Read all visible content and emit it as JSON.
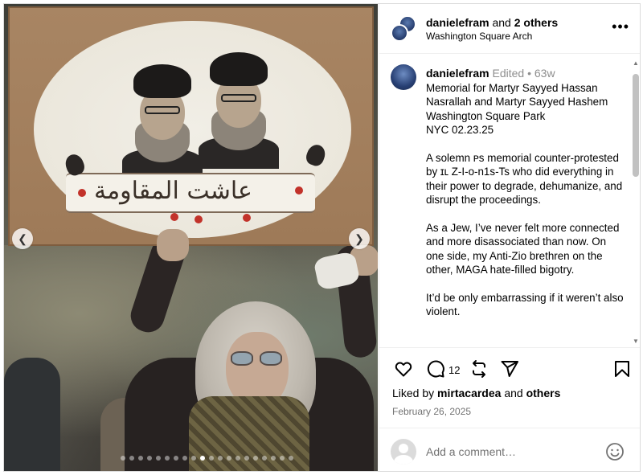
{
  "header": {
    "username": "danielefram",
    "connector": " and ",
    "others": "2 others",
    "location": "Washington Square Arch",
    "more_icon": "more-horizontal-icon"
  },
  "caption": {
    "username": "danielefram",
    "edited": "Edited",
    "separator": " • ",
    "age": "63w",
    "paragraphs": [
      "Memorial for Martyr Sayyed Hassan Nasrallah and Martyr Sayyed Hashem Washington Square Park\nNYC 02.23.25",
      "A solemn ᴘs memorial counter-protested by ɪʟ Z-I-o-n1s-Ts who did everything in their power to degrade, dehumanize, and disrupt the proceedings.",
      "As a Jew, I’ve never felt more connected and more disassociated than now. On one side, my Anti-Zio brethren on the other, MAGA hate-filled bigotry.",
      "It’d be only embarrassing if it weren’t also violent."
    ]
  },
  "media": {
    "sign_text": "عاشت المقاومة",
    "carousel_total": 20,
    "carousel_active": 10,
    "prev_icon": "chevron-left-icon",
    "next_icon": "chevron-right-icon"
  },
  "actions": {
    "comment_count": "12",
    "icons": [
      "heart-icon",
      "comment-icon",
      "repost-icon",
      "share-icon",
      "bookmark-icon"
    ]
  },
  "likes": {
    "prefix": "Liked by ",
    "user": "mirtacardea",
    "middle": " and ",
    "others": "others"
  },
  "date": "February 26, 2025",
  "comment": {
    "placeholder": "Add a comment…",
    "emoji_icon": "emoji-smile-icon"
  },
  "colors": {
    "border": "#dbdbdb",
    "muted": "#737373",
    "text": "#000000"
  }
}
